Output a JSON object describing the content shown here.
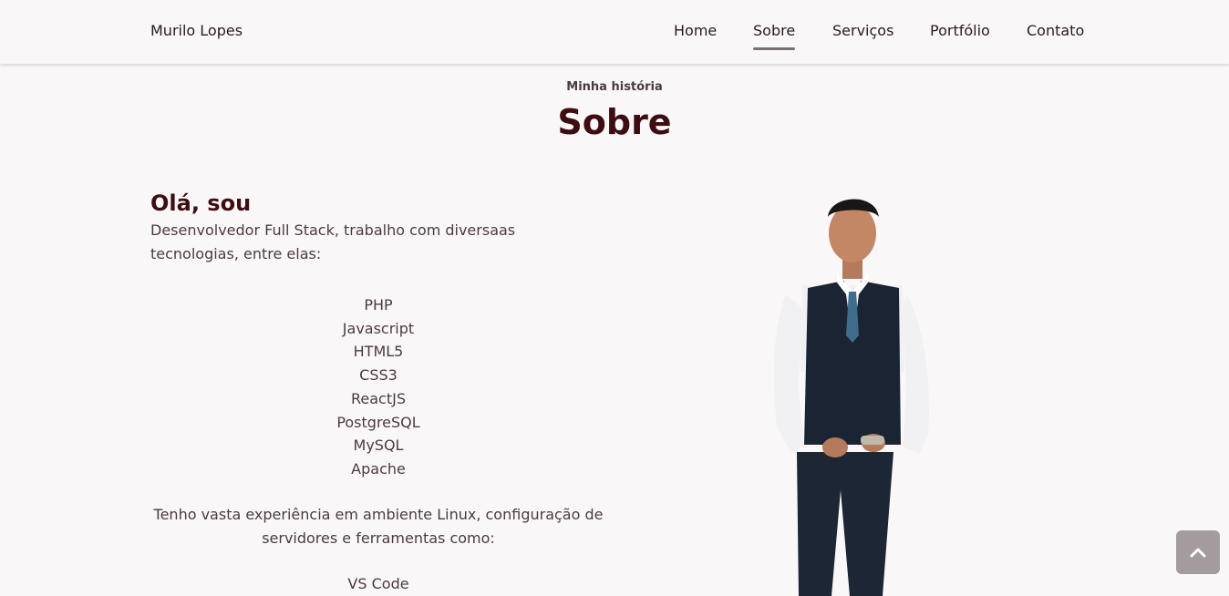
{
  "navbar": {
    "brand": "Murilo Lopes",
    "links": [
      {
        "label": "Home",
        "active": false
      },
      {
        "label": "Sobre",
        "active": true
      },
      {
        "label": "Serviços",
        "active": false
      },
      {
        "label": "Portfólio",
        "active": false
      },
      {
        "label": "Contato",
        "active": false
      }
    ]
  },
  "about": {
    "subtitle": "Minha história",
    "title": "Sobre",
    "greeting": "Olá, sou",
    "intro": "Desenvolvedor Full Stack, trabalho com diversaas tecnologias, entre elas:",
    "technologies": [
      "PHP",
      "Javascript",
      "HTML5",
      "CSS3",
      "ReactJS",
      "PostgreSQL",
      "MySQL",
      "Apache"
    ],
    "experience": "Tenho vasta experiência em ambiente Linux, configuração de servidores e ferramentas como:",
    "tools": [
      "VS Code"
    ]
  },
  "icons": {
    "back_to_top": "chevron-up-icon"
  },
  "colors": {
    "background": "#faf7f8",
    "heading": "#3d0d12",
    "text": "#4a3b3e",
    "active_underline": "#7a6f71",
    "back_to_top_button": "#a39b9d"
  }
}
